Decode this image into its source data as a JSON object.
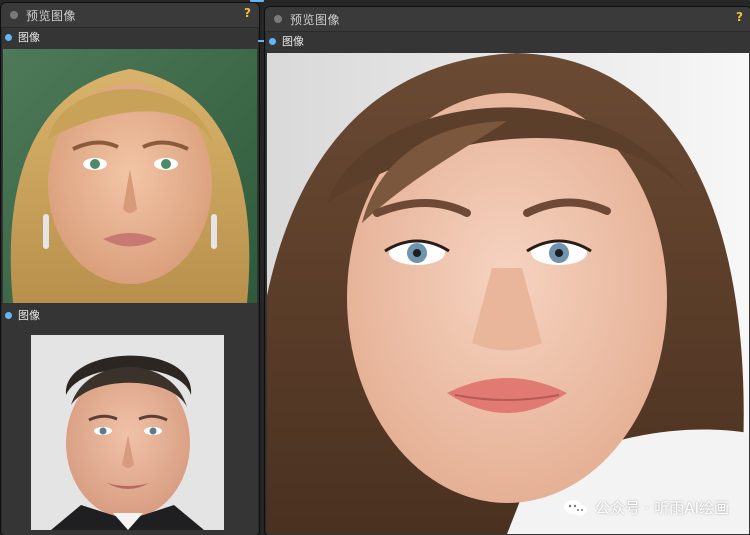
{
  "nodes": {
    "left": {
      "title": "预览图像",
      "help": "?",
      "inputs": [
        {
          "label": "图像"
        },
        {
          "label": "图像"
        }
      ]
    },
    "right": {
      "title": "预览图像",
      "help": "?",
      "input_label": "图像"
    }
  },
  "watermark": {
    "text": "公众号 · 听雨AI绘画"
  },
  "colors": {
    "node_bg": "#353535",
    "header_bg": "#3a3a3a",
    "slot_blue": "#64b5f6",
    "help_yellow": "#f0c040"
  }
}
